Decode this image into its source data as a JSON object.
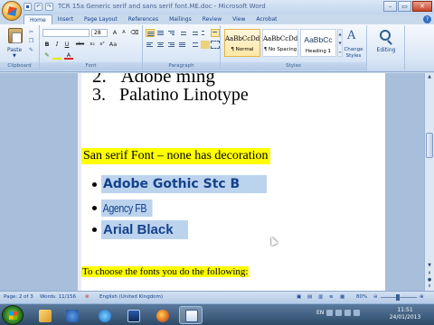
{
  "window": {
    "title": "TCR 15a Generic serif and sans serif font.ME.doc - Microsoft Word",
    "min": "–",
    "max": "▭",
    "close": "✕"
  },
  "qat": [
    "save-icon",
    "undo-icon",
    "redo-icon"
  ],
  "tabs": [
    "Home",
    "Insert",
    "Page Layout",
    "References",
    "Mailings",
    "Review",
    "View",
    "Acrobat"
  ],
  "help": "?",
  "ribbon": {
    "clipboard": {
      "paste": "Paste",
      "label": "Clipboard"
    },
    "font": {
      "name": "",
      "size": "28",
      "label": "Font",
      "buttons": [
        "B",
        "I",
        "U",
        "abe",
        "x₂",
        "x²",
        "Aa",
        "A",
        "A"
      ]
    },
    "paragraph": {
      "label": "Paragraph"
    },
    "styles": {
      "label": "Styles",
      "items": [
        {
          "preview": "AaBbCcDd",
          "name": "¶ Normal"
        },
        {
          "preview": "AaBbCcDd",
          "name": "¶ No Spacing"
        },
        {
          "preview": "AaBbCc",
          "name": "Heading 1"
        }
      ],
      "change": "Change Styles"
    },
    "editing": {
      "label": "Editing"
    }
  },
  "document": {
    "list_top": [
      {
        "num": "2.",
        "text": "Adobe ming"
      },
      {
        "num": "3.",
        "text": "Palatino Linotype"
      }
    ],
    "heading": "San serif Font – none has decoration",
    "bullets": [
      "Adobe Gothic Stc B",
      "Agency FB",
      "Arial Black"
    ],
    "footer_line": "To choose the fonts you do the following:"
  },
  "status": {
    "page": "Page: 2 of 3",
    "words": "Words: 11/156",
    "language": "English (United Kingdom)",
    "zoom": "80%"
  },
  "taskbar": {
    "tray_lang": "EN",
    "time": "11:51",
    "date": "24/01/2013"
  }
}
